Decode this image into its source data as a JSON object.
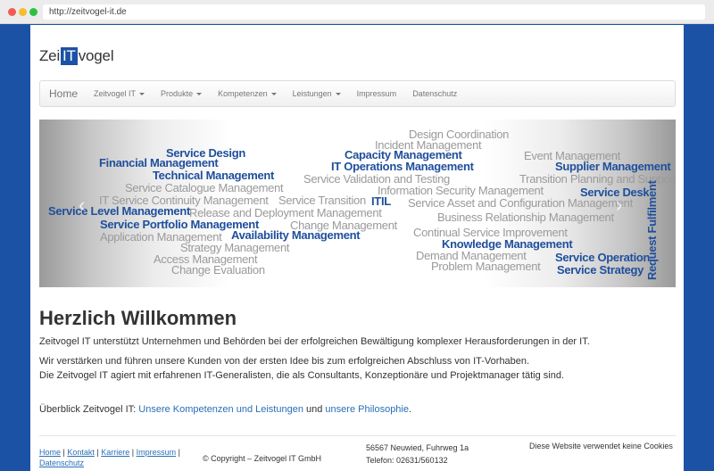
{
  "browser": {
    "url": "http://zeitvogel-it.de"
  },
  "logo": {
    "pre": "Zei",
    "mark": "IT",
    "post": "vogel"
  },
  "nav": {
    "brand": "Home",
    "items": [
      {
        "label": "Zeitvogel IT",
        "dropdown": true
      },
      {
        "label": "Produkte",
        "dropdown": true
      },
      {
        "label": "Kompetenzen",
        "dropdown": true
      },
      {
        "label": "Leistungen",
        "dropdown": true
      },
      {
        "label": "Impressum",
        "dropdown": false
      },
      {
        "label": "Datenschutz",
        "dropdown": false
      }
    ]
  },
  "carousel": {
    "prev": "‹",
    "next": "›",
    "words": [
      "Design Coordination",
      "Incident Management",
      "Service Design",
      "Capacity Management",
      "Event Management",
      "Financial Management",
      "IT Operations Management",
      "Supplier Management",
      "Technical Management",
      "Service Validation and Testing",
      "Transition Planning and Support",
      "Service Catalogue Management",
      "Information Security Management",
      "Service Desk",
      "IT Service Continuity Management",
      "Service Transition",
      "ITIL",
      "Service Asset and Configuration Management",
      "Service Level Management",
      "Release and Deployment Management",
      "Business Relationship Management",
      "Service Portfolio Management",
      "Change Management",
      "Request Fulfilment",
      "Application Management",
      "Availability Management",
      "Continual Service Improvement",
      "Strategy Management",
      "Knowledge Management",
      "Access Management",
      "Demand Management",
      "Service Operation",
      "Change Evaluation",
      "Problem Management",
      "Service Strategy"
    ]
  },
  "content": {
    "title": "Herzlich Willkommen",
    "p1": "Zeitvogel IT unterstützt Unternehmen und Behörden bei der erfolgreichen Bewältigung komplexer Herausforderungen in der IT.",
    "p2": "Wir verstärken und führen unsere Kunden von der ersten Idee bis zum erfolgreichen Abschluss von IT-Vorhaben.",
    "p3": "Die Zeitvogel IT agiert mit erfahrenen IT-Generalisten, die als Consultants, Konzeptionäre und Projektmanager tätig sind.",
    "overview_prefix": "Überblick Zeitvogel IT: ",
    "link1": "Unsere Kompetenzen und Leistungen",
    "middle": " und ",
    "link2": "unsere Philosophie",
    "suffix": "."
  },
  "footer": {
    "links": [
      "Home",
      "Kontakt",
      "Karriere",
      "Impressum",
      "Datenschutz"
    ],
    "sep": " | ",
    "copyright": "© Copyright – Zeitvogel IT GmbH",
    "address": "56567 Neuwied, Fuhrweg 1a",
    "phone": "Telefon: 02631/560132",
    "cookie": "Diese Website verwendet keine Cookies"
  }
}
